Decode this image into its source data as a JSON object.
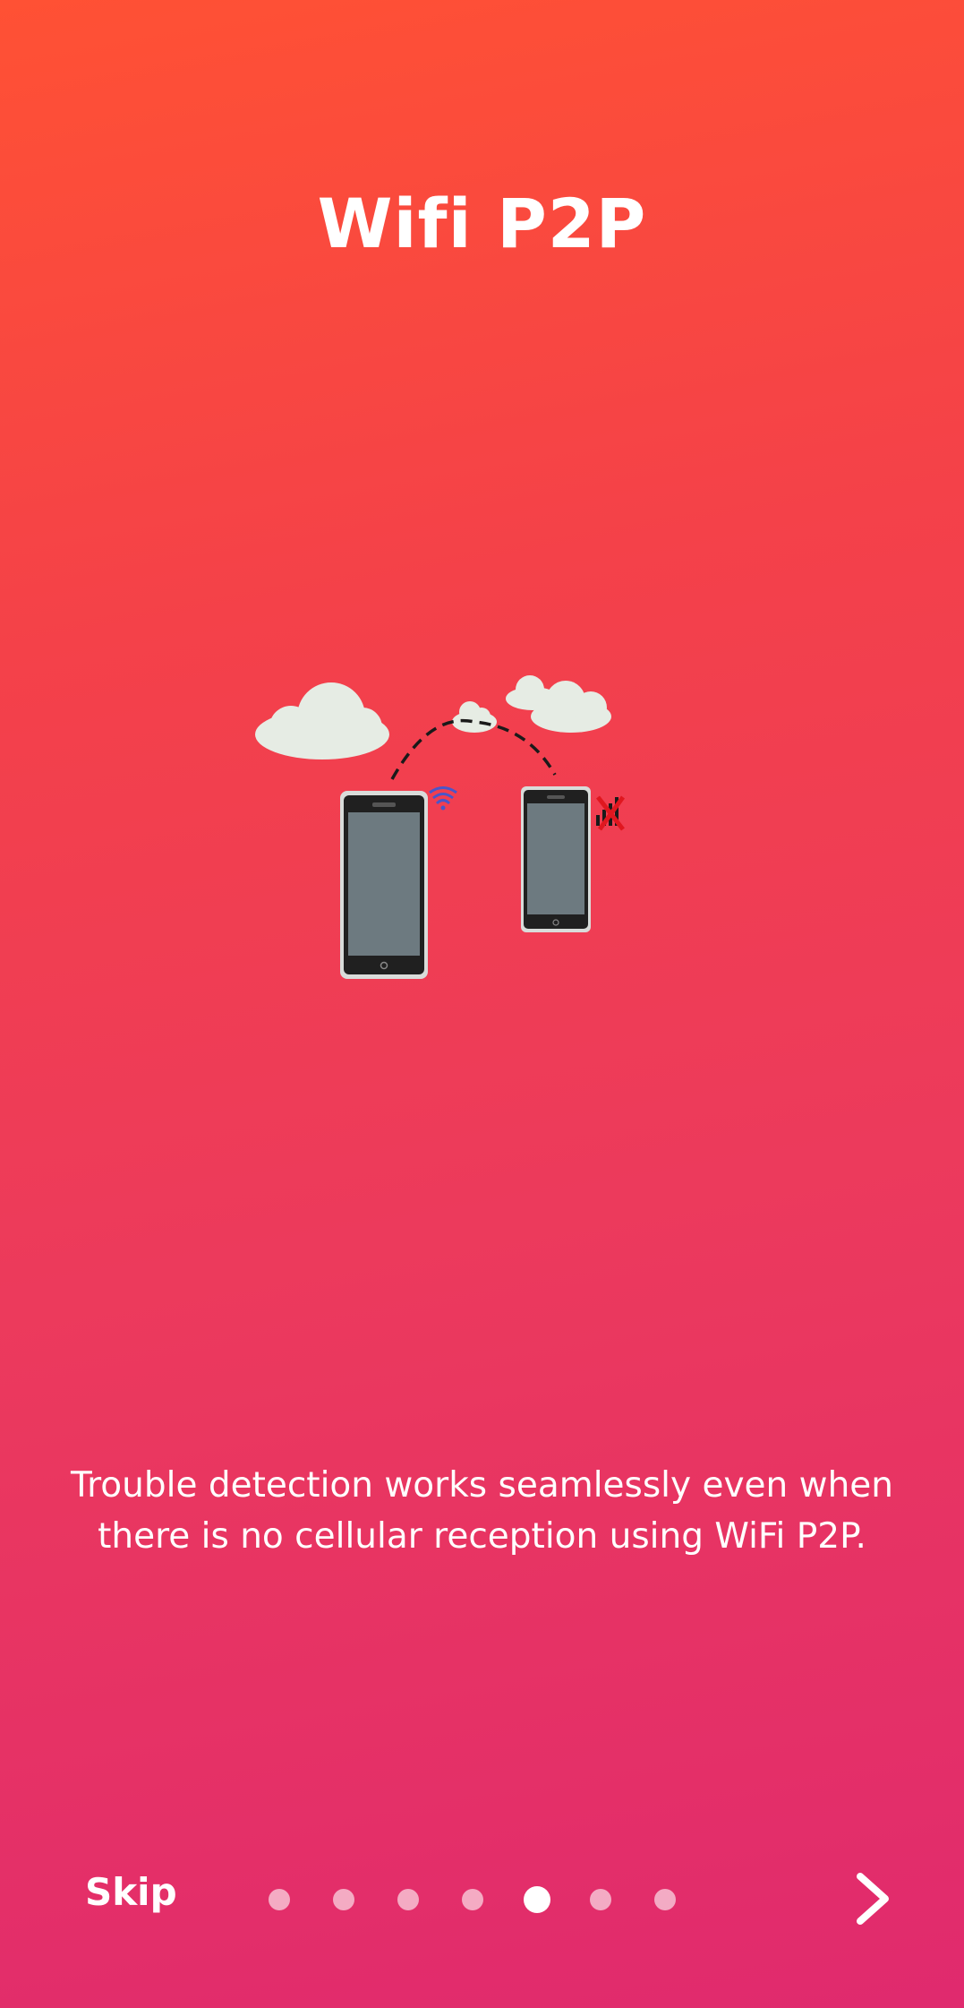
{
  "onboarding": {
    "title": "Wifi P2P",
    "description": "Trouble detection works seamlessly even when there is no cellular reception using WiFi P2P.",
    "skip_label": "Skip",
    "page_count": 7,
    "active_page": 5
  },
  "colors": {
    "gradient_top": "#ff5134",
    "gradient_bottom": "#e02a6e",
    "text": "#ffffff",
    "dot_inactive": "#d9d9d9",
    "dot_active": "#ffffff"
  },
  "icons": {
    "next": "chevron-right-icon",
    "illustration": "two-phones-wifi-p2p-illustration"
  }
}
